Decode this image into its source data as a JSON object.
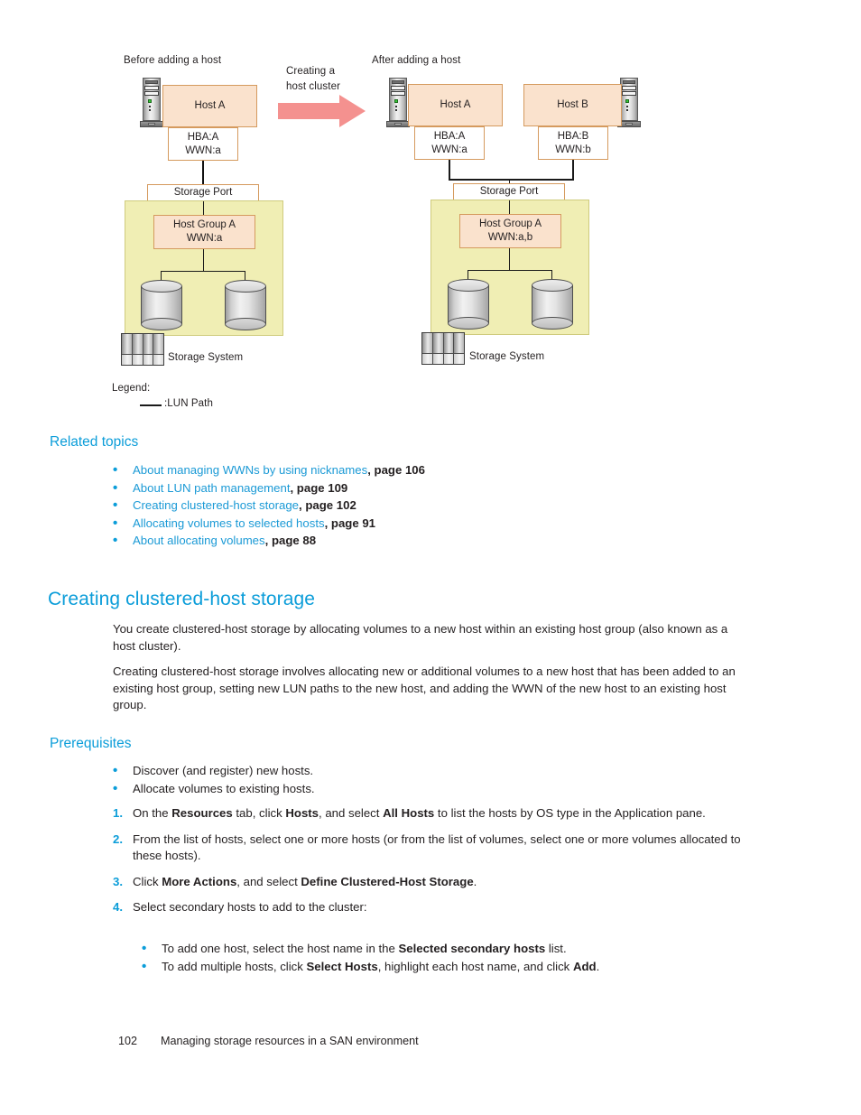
{
  "figure": {
    "left_caption": "Before adding a host",
    "right_caption": "After adding a host",
    "transition_label_line1": "Creating a",
    "transition_label_line2": "host cluster",
    "arrow_color": "#F4918F",
    "before": {
      "host_box": "Host A",
      "hba_line1": "HBA:A",
      "hba_line2": "WWN:a",
      "storage_port": "Storage Port",
      "host_group_line1": "Host Group A",
      "host_group_line2": "WWN:a",
      "storage_system": "Storage System"
    },
    "after": {
      "host_a_box": "Host A",
      "host_b_box": "Host B",
      "hba_a_line1": "HBA:A",
      "hba_a_line2": "WWN:a",
      "hba_b_line1": "HBA:B",
      "hba_b_line2": "WWN:b",
      "storage_port": "Storage Port",
      "host_group_line1": "Host Group A",
      "host_group_line2": "WWN:a,b",
      "storage_system": "Storage System"
    },
    "legend": {
      "title": "Legend:",
      "lun_path": ":LUN Path"
    },
    "colors": {
      "host_box_fill": "#FAE2CD",
      "host_box_border": "#D59A5E",
      "region_fill": "#F0EEB4",
      "region_border": "#CFCB7D"
    }
  },
  "related_topics": {
    "heading": "Related topics",
    "items": [
      {
        "link": "About managing WWNs by using nicknames",
        "page": ", page 106"
      },
      {
        "link": "About LUN path management",
        "page": ", page 109"
      },
      {
        "link": "Creating clustered-host storage",
        "page": ", page 102"
      },
      {
        "link": "Allocating volumes to selected hosts",
        "page": ", page 91"
      },
      {
        "link": "About allocating volumes",
        "page": ", page 88"
      }
    ]
  },
  "section": {
    "heading": "Creating clustered-host storage",
    "paragraph1": "You create clustered-host storage by allocating volumes to a new host within an existing host group (also known as a host cluster).",
    "paragraph2": "Creating clustered-host storage involves allocating new or additional volumes to a new host that has been added to an existing host group, setting new LUN paths to the new host, and adding the WWN of the new host to an existing host group."
  },
  "prerequisites": {
    "heading": "Prerequisites",
    "bullets": [
      "Discover (and register) new hosts.",
      "Allocate volumes to existing hosts."
    ],
    "steps": [
      {
        "number": "1.",
        "text_parts": [
          "On the ",
          "Resources",
          " tab, click ",
          "Hosts",
          ", and select ",
          "All Hosts",
          " to list the hosts by OS type in the Application pane."
        ]
      },
      {
        "number": "2.",
        "text_parts": [
          "From the list of hosts, select one or more hosts (or from the list of volumes, select one or more volumes allocated to these hosts)."
        ]
      },
      {
        "number": "3.",
        "text_parts": [
          "Click ",
          "More Actions",
          ", and select ",
          "Define Clustered-Host Storage",
          "."
        ]
      },
      {
        "number": "4.",
        "text_parts": [
          "Select secondary hosts to add to the cluster:"
        ]
      }
    ],
    "substeps": [
      {
        "parts": [
          "To add one host, select the host name in the ",
          "Selected secondary hosts",
          " list."
        ]
      },
      {
        "parts": [
          "To add multiple hosts, click ",
          "Select Hosts",
          ", highlight each host name, and click ",
          "Add",
          "."
        ]
      }
    ]
  },
  "footer": {
    "page_number": "102",
    "chapter_title": "Managing storage resources in a SAN environment"
  }
}
